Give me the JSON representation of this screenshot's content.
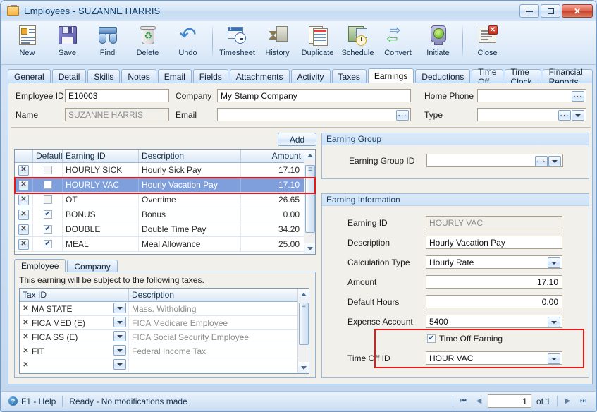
{
  "window": {
    "title": "Employees - SUZANNE HARRIS",
    "icon": "employee-folder-icon",
    "minimize_label": "Minimize",
    "restore_label": "Restore",
    "close_label": "✕"
  },
  "toolbar": {
    "items": [
      {
        "label": "New",
        "icon": "new-document-icon"
      },
      {
        "label": "Save",
        "icon": "floppy-disk-icon"
      },
      {
        "label": "Find",
        "icon": "binoculars-icon"
      },
      {
        "label": "Delete",
        "icon": "trash-can-icon"
      },
      {
        "label": "Undo",
        "icon": "undo-arrow-icon"
      },
      {
        "label": "Timesheet",
        "icon": "timesheet-clock-icon"
      },
      {
        "label": "History",
        "icon": "hourglass-history-icon"
      },
      {
        "label": "Duplicate",
        "icon": "duplicate-pages-icon"
      },
      {
        "label": "Schedule",
        "icon": "schedule-calendar-icon"
      },
      {
        "label": "Convert",
        "icon": "convert-arrows-icon"
      },
      {
        "label": "Initiate",
        "icon": "traffic-light-icon"
      },
      {
        "label": "Close",
        "icon": "close-window-icon"
      }
    ]
  },
  "tabs": [
    {
      "label": "General",
      "active": false
    },
    {
      "label": "Detail",
      "active": false
    },
    {
      "label": "Skills",
      "active": false
    },
    {
      "label": "Notes",
      "active": false
    },
    {
      "label": "Email",
      "active": false
    },
    {
      "label": "Fields",
      "active": false
    },
    {
      "label": "Attachments",
      "active": false
    },
    {
      "label": "Activity",
      "active": false
    },
    {
      "label": "Taxes",
      "active": false
    },
    {
      "label": "Earnings",
      "active": true
    },
    {
      "label": "Deductions",
      "active": false
    },
    {
      "label": "Time Off",
      "active": false
    },
    {
      "label": "Time Clock",
      "active": false
    },
    {
      "label": "Financial Reports",
      "active": false
    }
  ],
  "header_form": {
    "employee_id_label": "Employee ID",
    "employee_id_value": "E10003",
    "name_label": "Name",
    "name_value": "SUZANNE HARRIS",
    "company_label": "Company",
    "company_value": "My Stamp Company",
    "email_label": "Email",
    "email_value": "",
    "home_phone_label": "Home Phone",
    "home_phone_value": "",
    "type_label": "Type",
    "type_value": ""
  },
  "earnings_grid": {
    "add_button": "Add",
    "columns": [
      "",
      "Default",
      "Earning ID",
      "Description",
      "Amount"
    ],
    "rows": [
      {
        "default": false,
        "earning_id": "HOURLY SICK",
        "description": "Hourly Sick Pay",
        "amount": "17.10",
        "selected": false
      },
      {
        "default": false,
        "earning_id": "HOURLY VAC",
        "description": "Hourly Vacation Pay",
        "amount": "17.10",
        "selected": true
      },
      {
        "default": false,
        "earning_id": "OT",
        "description": "Overtime",
        "amount": "26.65",
        "selected": false
      },
      {
        "default": true,
        "earning_id": "BONUS",
        "description": "Bonus",
        "amount": "0.00",
        "selected": false
      },
      {
        "default": true,
        "earning_id": "DOUBLE",
        "description": "Double Time Pay",
        "amount": "34.20",
        "selected": false
      },
      {
        "default": true,
        "earning_id": "MEAL",
        "description": "Meal Allowance",
        "amount": "25.00",
        "selected": false
      }
    ]
  },
  "tax_section": {
    "tabs": [
      {
        "label": "Employee",
        "active": true
      },
      {
        "label": "Company",
        "active": false
      }
    ],
    "note": "This earning will be subject to the following taxes.",
    "columns": [
      "Tax ID",
      "Description"
    ],
    "rows": [
      {
        "tax_id": "MA STATE",
        "description": "Mass. Witholding"
      },
      {
        "tax_id": "FICA MED (E)",
        "description": "FICA Medicare Employee"
      },
      {
        "tax_id": "FICA SS (E)",
        "description": "FICA Social Security Employee"
      },
      {
        "tax_id": "FIT",
        "description": "Federal Income Tax"
      },
      {
        "tax_id": "",
        "description": ""
      }
    ]
  },
  "earning_group": {
    "caption": "Earning Group",
    "id_label": "Earning Group ID",
    "id_value": ""
  },
  "earning_information": {
    "caption": "Earning Information",
    "earning_id_label": "Earning ID",
    "earning_id_value": "HOURLY VAC",
    "description_label": "Description",
    "description_value": "Hourly Vacation Pay",
    "calculation_type_label": "Calculation Type",
    "calculation_type_value": "Hourly Rate",
    "amount_label": "Amount",
    "amount_value": "17.10",
    "default_hours_label": "Default Hours",
    "default_hours_value": "0.00",
    "expense_account_label": "Expense Account",
    "expense_account_value": "5400",
    "time_off_earning_label": "Time Off Earning",
    "time_off_earning_checked": true,
    "time_off_id_label": "Time Off ID",
    "time_off_id_value": "HOUR VAC"
  },
  "status_bar": {
    "help_label": "F1 - Help",
    "status_text": "Ready - No modifications made",
    "page_value": "1",
    "of_text": "of 1"
  },
  "colors": {
    "highlight_red": "#e61717",
    "selection_blue": "#7f9fdc",
    "accent_blue": "#15395e"
  }
}
